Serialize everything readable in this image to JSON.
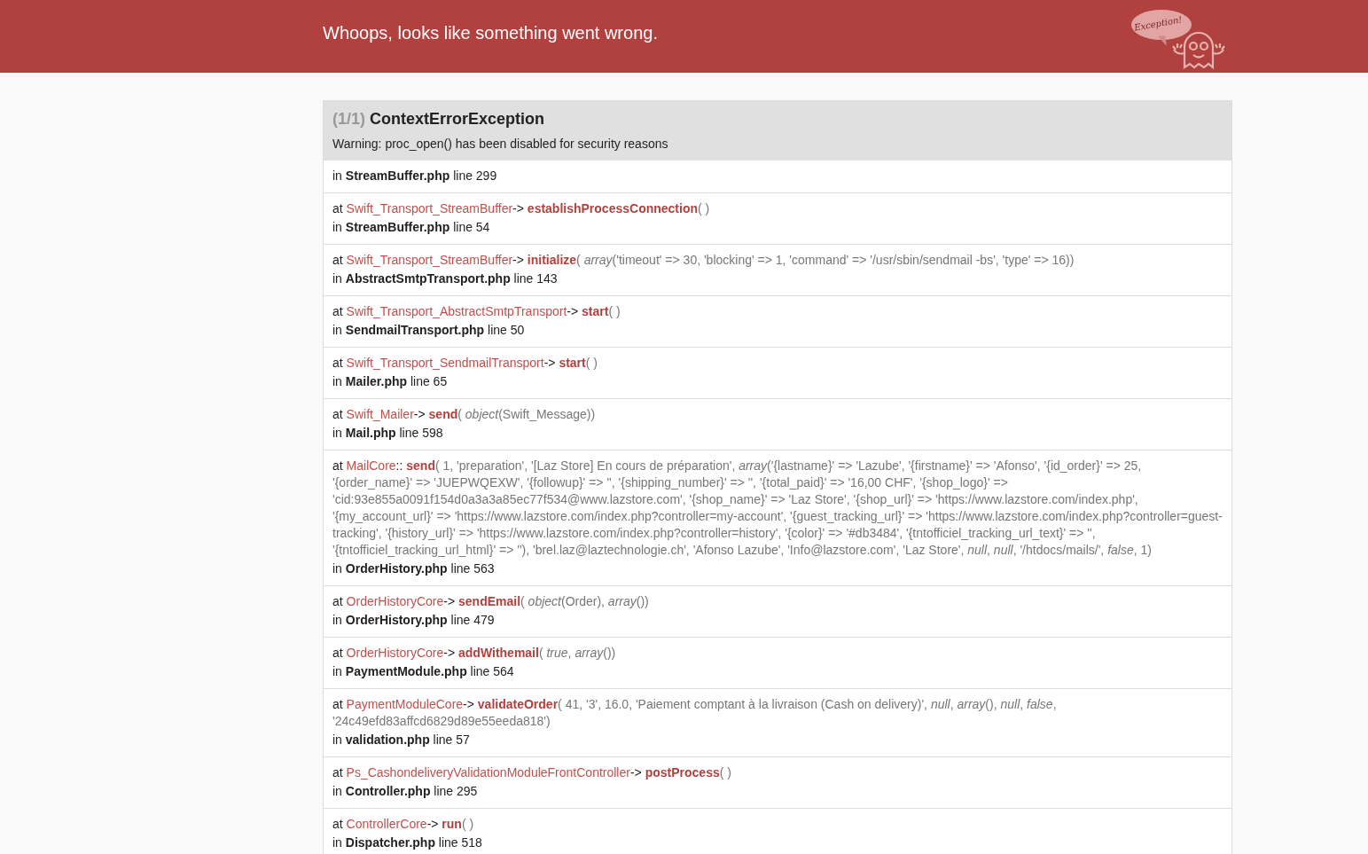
{
  "header": {
    "title": "Whoops, looks like something went wrong.",
    "logo_text": "Exception!"
  },
  "exception": {
    "count": "(1/1)",
    "name": "ContextErrorException",
    "message": "Warning: proc_open() has been disabled for security reasons"
  },
  "trace": [
    {
      "location": {
        "prefix": "in",
        "file": "StreamBuffer.php",
        "line": "line 299"
      }
    },
    {
      "call": {
        "prefix": "at",
        "class": "Swift_Transport_StreamBuffer",
        "type": "->",
        "function": "establishProcessConnection",
        "args": "( )"
      },
      "location": {
        "prefix": "in",
        "file": "StreamBuffer.php",
        "line": "line 54"
      }
    },
    {
      "call": {
        "prefix": "at",
        "class": "Swift_Transport_StreamBuffer",
        "type": "->",
        "function": "initialize",
        "args": "( *array*('timeout' => 30, 'blocking' => 1, 'command' => '/usr/sbin/sendmail -bs', 'type' => 16))"
      },
      "location": {
        "prefix": "in",
        "file": "AbstractSmtpTransport.php",
        "line": "line 143"
      }
    },
    {
      "call": {
        "prefix": "at",
        "class": "Swift_Transport_AbstractSmtpTransport",
        "type": "->",
        "function": "start",
        "args": "( )"
      },
      "location": {
        "prefix": "in",
        "file": "SendmailTransport.php",
        "line": "line 50"
      }
    },
    {
      "call": {
        "prefix": "at",
        "class": "Swift_Transport_SendmailTransport",
        "type": "->",
        "function": "start",
        "args": "( )"
      },
      "location": {
        "prefix": "in",
        "file": "Mailer.php",
        "line": "line 65"
      }
    },
    {
      "call": {
        "prefix": "at",
        "class": "Swift_Mailer",
        "type": "->",
        "function": "send",
        "args": "( *object*(Swift_Message))"
      },
      "location": {
        "prefix": "in",
        "file": "Mail.php",
        "line": "line 598"
      }
    },
    {
      "call": {
        "prefix": "at",
        "class": "MailCore",
        "type": "::",
        "function": "send",
        "args": "( 1, 'preparation', '[Laz Store] En cours de préparation', *array*('{lastname}' => 'Lazube', '{firstname}' => 'Afonso', '{id_order}' => 25, '{order_name}' => 'JUEPWQEXW', '{followup}' => '', '{shipping_number}' => '', '{total_paid}' => '16,00 CHF', '{shop_logo}' => 'cid:93e855a0091f154d0a3a3a85ec77f534@www.lazstore.com', '{shop_name}' => 'Laz Store', '{shop_url}' => 'https://www.lazstore.com/index.php', '{my_account_url}' => 'https://www.lazstore.com/index.php?controller=my-account', '{guest_tracking_url}' => 'https://www.lazstore.com/index.php?controller=guest-tracking', '{history_url}' => 'https://www.lazstore.com/index.php?controller=history', '{color}' => '#db3484', '{tntofficiel_tracking_url_text}' => '', '{tntofficiel_tracking_url_html}' => ''), 'brel.laz@laztechnologie.ch', 'Afonso Lazube', 'Info@lazstore.com', 'Laz Store', *null*, *null*, '/htdocs/mails/', *false*, 1)"
      },
      "location": {
        "prefix": "in",
        "file": "OrderHistory.php",
        "line": "line 563"
      }
    },
    {
      "call": {
        "prefix": "at",
        "class": "OrderHistoryCore",
        "type": "->",
        "function": "sendEmail",
        "args": "( *object*(Order), *array*())"
      },
      "location": {
        "prefix": "in",
        "file": "OrderHistory.php",
        "line": "line 479"
      }
    },
    {
      "call": {
        "prefix": "at",
        "class": "OrderHistoryCore",
        "type": "->",
        "function": "addWithemail",
        "args": "( *true*, *array*())"
      },
      "location": {
        "prefix": "in",
        "file": "PaymentModule.php",
        "line": "line 564"
      }
    },
    {
      "call": {
        "prefix": "at",
        "class": "PaymentModuleCore",
        "type": "->",
        "function": "validateOrder",
        "args": "( 41, '3', 16.0, 'Paiement comptant à la livraison (Cash on delivery)', *null*, *array*(), *null*, *false*, '24c49efd83affcd6829d89e55eeda818')"
      },
      "location": {
        "prefix": "in",
        "file": "validation.php",
        "line": "line 57"
      }
    },
    {
      "call": {
        "prefix": "at",
        "class": "Ps_CashondeliveryValidationModuleFrontController",
        "type": "->",
        "function": "postProcess",
        "args": "( )"
      },
      "location": {
        "prefix": "in",
        "file": "Controller.php",
        "line": "line 295"
      }
    },
    {
      "call": {
        "prefix": "at",
        "class": "ControllerCore",
        "type": "->",
        "function": "run",
        "args": "( )"
      },
      "location": {
        "prefix": "in",
        "file": "Dispatcher.php",
        "line": "line 518"
      }
    }
  ]
}
